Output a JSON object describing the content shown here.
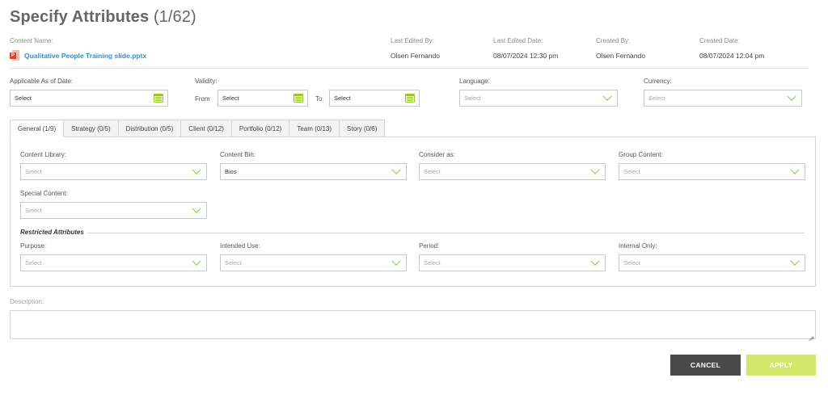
{
  "header": {
    "title": "Specify Attributes",
    "count": "(1/62)"
  },
  "meta": {
    "content_name_label": "Content Name:",
    "content_name": "Qualitative People Training slide.pptx",
    "file_badge": "P",
    "last_edited_by_label": "Last Edited By:",
    "last_edited_by": "Olsen Fernando",
    "last_edited_date_label": "Last Edited Date:",
    "last_edited_date": "08/07/2024 12:30 pm",
    "created_by_label": "Created By:",
    "created_by": "Olsen Fernando",
    "created_date_label": "Created Date:",
    "created_date": "08/07/2024 12:04 pm"
  },
  "top_fields": {
    "applicable_label": "Applicable As of Date:",
    "applicable_value": "Select",
    "validity_label": "Validity:",
    "from_label": "From",
    "from_value": "Select",
    "to_label": "To",
    "to_value": "Select",
    "language_label": "Language:",
    "language_placeholder": "Select",
    "currency_label": "Currency:",
    "currency_placeholder": "Select"
  },
  "tabs": [
    {
      "label": "General (1/9)",
      "active": true
    },
    {
      "label": "Strategy (0/5)",
      "active": false
    },
    {
      "label": "Distribution (0/5)",
      "active": false
    },
    {
      "label": "Client (0/12)",
      "active": false
    },
    {
      "label": "Portfolio (0/12)",
      "active": false
    },
    {
      "label": "Team (0/13)",
      "active": false
    },
    {
      "label": "Story (0/6)",
      "active": false
    }
  ],
  "general": {
    "content_library_label": "Content Library:",
    "content_library_placeholder": "Select",
    "content_bin_label": "Content Bin:",
    "content_bin_value": "Bios",
    "consider_as_label": "Consider as:",
    "consider_as_placeholder": "Select",
    "group_content_label": "Group Content:",
    "group_content_placeholder": "Select",
    "special_content_label": "Special Content:",
    "special_content_placeholder": "Select",
    "restricted_title": "Restricted Attributes",
    "purpose_label": "Purpose:",
    "purpose_placeholder": "Select",
    "intended_use_label": "Intended Use:",
    "intended_use_placeholder": "Select",
    "period_label": "Period:",
    "period_placeholder": "Select",
    "internal_only_label": "Internal Only:",
    "internal_only_placeholder": "Select"
  },
  "description": {
    "label": "Description:",
    "value": ""
  },
  "actions": {
    "cancel_label": "CANCEL",
    "apply_label": "APPLY"
  },
  "colors": {
    "accent_green": "#8dc63f",
    "link_blue": "#2b8fd6",
    "cancel_bg": "#4a4a4a",
    "apply_bg": "#d3e86a",
    "ppt_red": "#d24726"
  },
  "icons": {
    "file": "powerpoint-file-icon",
    "date": "calendar-icon",
    "dropdown": "chevron-down-icon",
    "resize": "resize-handle-icon"
  }
}
